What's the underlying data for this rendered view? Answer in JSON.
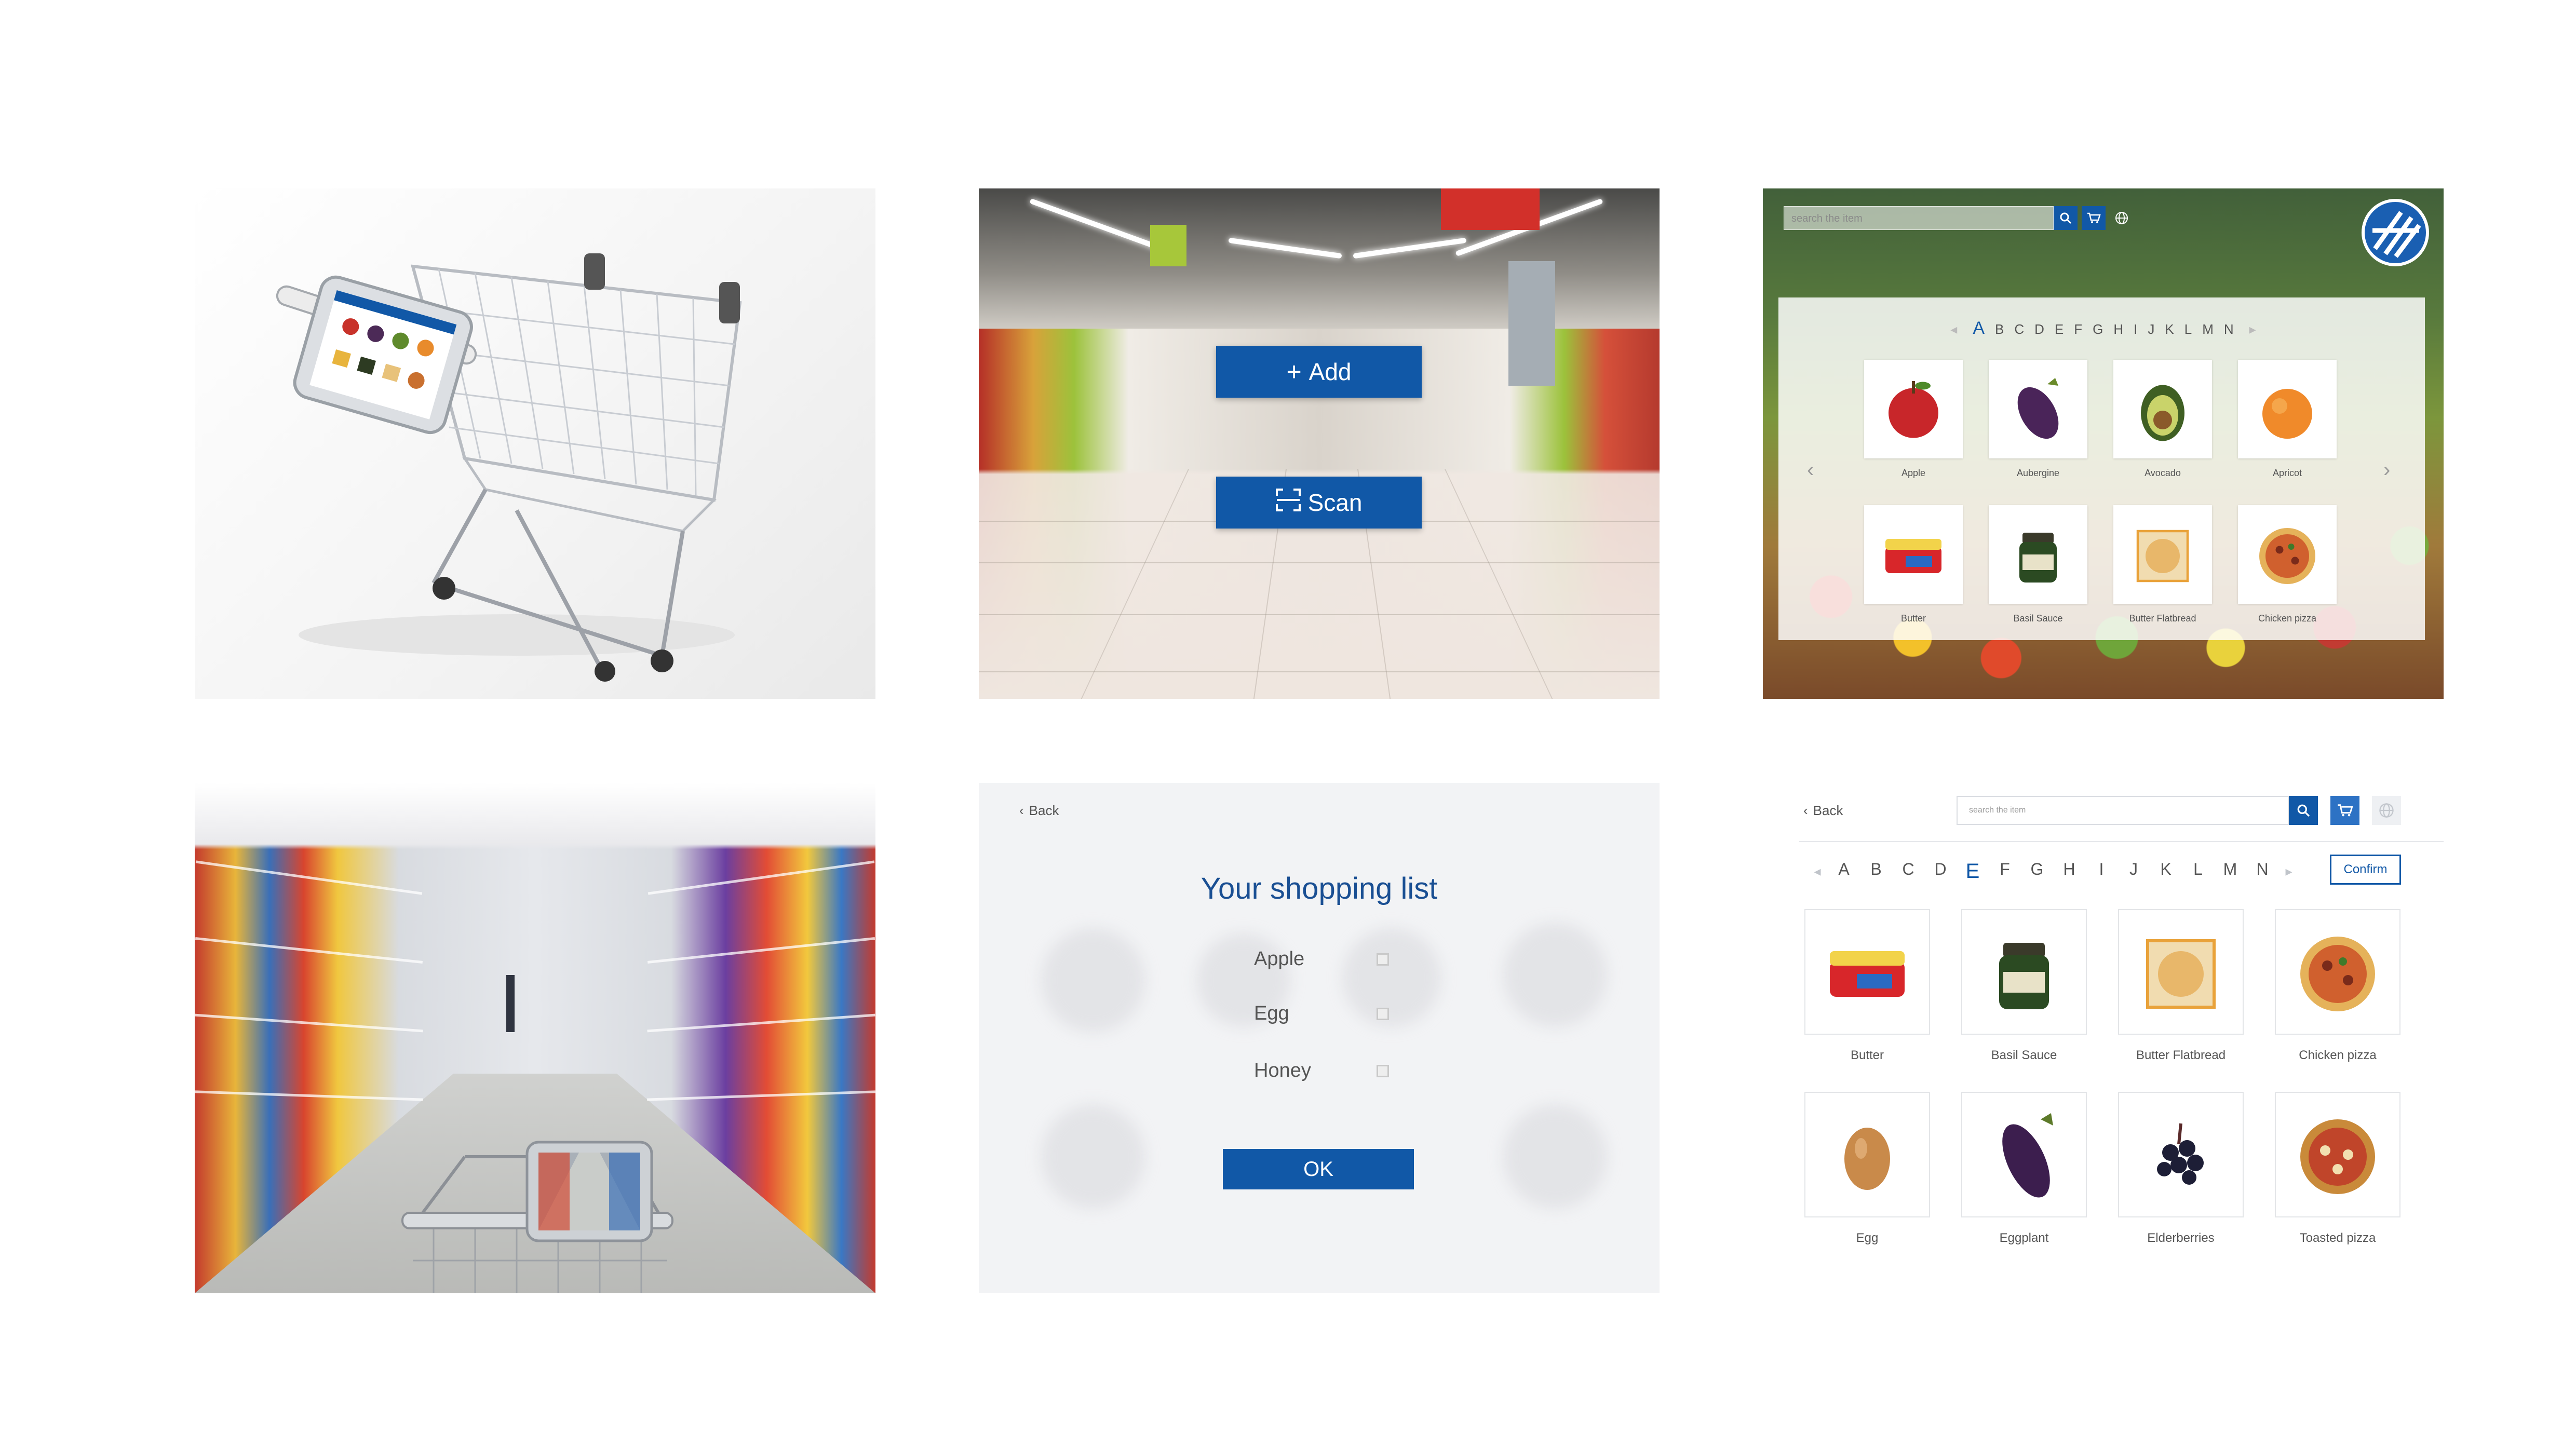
{
  "colors": {
    "primary_blue": "#1158a7",
    "title_blue": "#1a4f93",
    "panel_gray": "#f2f3f5"
  },
  "p2": {
    "add_button": {
      "icon": "plus-icon",
      "label": "Add"
    },
    "scan_button": {
      "icon": "scan-icon",
      "label": "Scan"
    }
  },
  "p3": {
    "search_placeholder": "search the item",
    "letters": [
      "A",
      "B",
      "C",
      "D",
      "E",
      "F",
      "G",
      "H",
      "I",
      "J",
      "K",
      "L",
      "M",
      "N"
    ],
    "active_letter": "A",
    "items": [
      {
        "label": "Apple",
        "icon": "apple-icon"
      },
      {
        "label": "Aubergine",
        "icon": "aubergine-icon"
      },
      {
        "label": "Avocado",
        "icon": "avocado-icon"
      },
      {
        "label": "Apricot",
        "icon": "apricot-icon"
      },
      {
        "label": "Butter",
        "icon": "butter-icon"
      },
      {
        "label": "Basil Sauce",
        "icon": "basil-sauce-icon"
      },
      {
        "label": "Butter Flatbread",
        "icon": "flatbread-icon"
      },
      {
        "label": "Chicken pizza",
        "icon": "pizza-icon"
      }
    ]
  },
  "p5": {
    "back_label": "Back",
    "title": "Your shopping list",
    "list": [
      "Apple",
      "Egg",
      "Honey"
    ],
    "ok_label": "OK"
  },
  "p6": {
    "back_label": "Back",
    "search_placeholder": "search the item",
    "letters": [
      "A",
      "B",
      "C",
      "D",
      "E",
      "F",
      "G",
      "H",
      "I",
      "J",
      "K",
      "L",
      "M",
      "N"
    ],
    "active_letter": "E",
    "confirm_label": "Confirm",
    "items": [
      {
        "label": "Butter",
        "icon": "butter-icon"
      },
      {
        "label": "Basil Sauce",
        "icon": "basil-sauce-icon"
      },
      {
        "label": "Butter Flatbread",
        "icon": "flatbread-icon"
      },
      {
        "label": "Chicken pizza",
        "icon": "pizza-icon"
      },
      {
        "label": "Egg",
        "icon": "egg-icon"
      },
      {
        "label": "Eggplant",
        "icon": "eggplant-icon"
      },
      {
        "label": "Elderberries",
        "icon": "elderberries-icon"
      },
      {
        "label": "Toasted pizza",
        "icon": "toasted-pizza-icon"
      }
    ]
  }
}
